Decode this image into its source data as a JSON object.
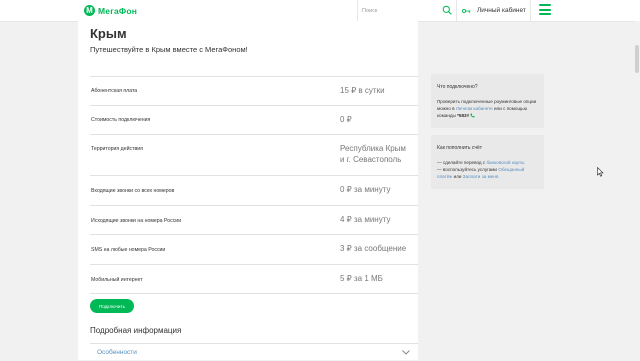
{
  "header": {
    "logo_text": "МегаФон",
    "search_placeholder": "Поиск",
    "cabinet_label": "Личный кабинет"
  },
  "main": {
    "title": "Крым",
    "intro": "Путешествуйте в Крым вместе с МегаФоном!",
    "params": [
      {
        "label": "Абонентская плата",
        "value": "15 ₽ в сутки"
      },
      {
        "label": "Стоимость подключения",
        "value": "0 ₽"
      },
      {
        "label": "Территория действия",
        "value": "Республика Крым\nи г. Севастополь"
      },
      {
        "label": "Входящие звонки со всех номеров",
        "value": "0 ₽ за минуту"
      },
      {
        "label": "Исходящие звонки на номера России",
        "value": "4 ₽ за минуту"
      },
      {
        "label": "SMS на любые номера России",
        "value": "3 ₽ за сообщение"
      },
      {
        "label": "Мобильный интернет",
        "value": "5 ₽ за 1 МБ"
      }
    ],
    "connect_button": "Подключить",
    "details_heading": "Подробная информация",
    "accordion_label": "Особенности"
  },
  "sidebar": {
    "check": {
      "title": "Что подключено?",
      "text_1": "Проверить подключенные роуминговые опции можно в ",
      "link": "Личном кабинете",
      "text_2": " или с помощью команды ",
      "code": "*583#"
    },
    "topup": {
      "title": "Как пополнить счёт",
      "line1_text": "— сделайте перевод с ",
      "line1_link": "банковской карты",
      "line2_text": "— воспользуйтесь услугами ",
      "line2_link": "Обещанный платёж",
      "line2_or": " или ",
      "line2_link2": "Заплати за меня."
    }
  },
  "colors": {
    "brand": "#00b956",
    "link": "#5a8fbe",
    "sidebar_bg": "#e9e9e9",
    "page_bg": "#f1f1f1"
  }
}
